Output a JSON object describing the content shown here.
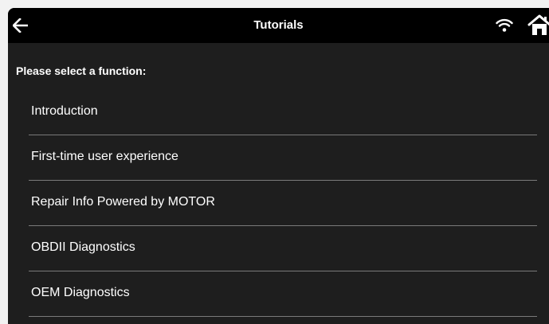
{
  "app": {
    "title": "Tutorials"
  },
  "header": {
    "back_icon": "arrow-left-icon",
    "wifi_icon": "wifi-icon",
    "home_icon": "home-icon"
  },
  "prompt": "Please select a function:",
  "menu": {
    "items": [
      {
        "label": "Introduction"
      },
      {
        "label": "First-time user experience"
      },
      {
        "label": "Repair Info Powered by MOTOR"
      },
      {
        "label": "OBDII Diagnostics"
      },
      {
        "label": "OEM Diagnostics"
      }
    ]
  },
  "colors": {
    "background": "#1e1e1e",
    "topbar": "#000000",
    "text": "#ffffff",
    "divider": "#7a7a7a"
  }
}
